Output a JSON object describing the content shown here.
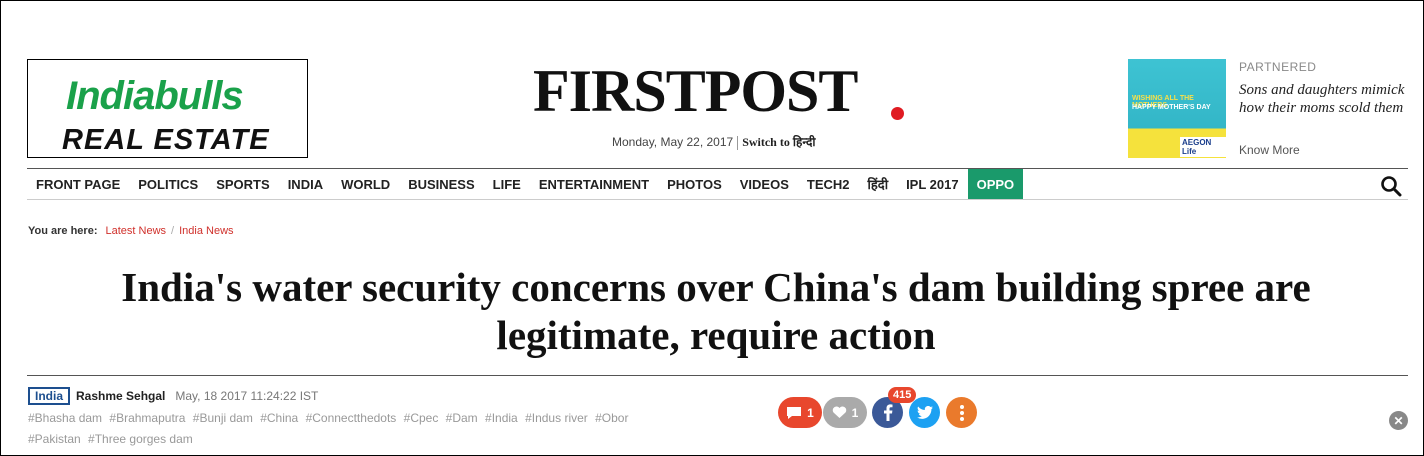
{
  "ad_left": {
    "line1": "Indiabulls",
    "line2": "REAL ESTATE"
  },
  "logo": {
    "text": "FIRSTPOST"
  },
  "dateline": {
    "date": "Monday, May 22, 2017",
    "switch": "Switch to हिन्दी"
  },
  "partnered": {
    "label": "PARTNERED",
    "image_line1": "WISHING ALL THE MOTHERS",
    "image_line2": "HAPPY MOTHER'S DAY",
    "image_brand": "AEGON Life",
    "title": "Sons and daughters mimick how their moms scold them",
    "more": "Know More"
  },
  "nav": {
    "items": [
      {
        "label": "FRONT PAGE"
      },
      {
        "label": "POLITICS"
      },
      {
        "label": "SPORTS"
      },
      {
        "label": "INDIA"
      },
      {
        "label": "WORLD"
      },
      {
        "label": "BUSINESS"
      },
      {
        "label": "LIFE"
      },
      {
        "label": "ENTERTAINMENT"
      },
      {
        "label": "PHOTOS"
      },
      {
        "label": "VIDEOS"
      },
      {
        "label": "TECH2"
      },
      {
        "label": "हिंदी"
      },
      {
        "label": "IPL 2017"
      },
      {
        "label": "OPPO"
      }
    ],
    "search_icon": "search-icon"
  },
  "breadcrumb": {
    "label": "You are here:",
    "items": [
      "Latest News",
      "India News"
    ]
  },
  "article": {
    "headline": "India's water security concerns over China's dam building spree are legitimate, require action",
    "section": "India",
    "author": "Rashme Sehgal",
    "timestamp": "May, 18 2017 11:24:22 IST",
    "tags": [
      "#Bhasha dam",
      "#Brahmaputra",
      "#Bunji dam",
      "#China",
      "#Connectthedots",
      "#Cpec",
      "#Dam",
      "#India",
      "#Indus river",
      "#Obor",
      "#Pakistan",
      "#Three gorges dam"
    ]
  },
  "share": {
    "comments": "1",
    "likes": "1",
    "facebook_count": "415"
  },
  "colors": {
    "brand_red": "#e01b22",
    "link_red": "#d0302b",
    "oppo_green": "#1a9a6b",
    "fb": "#3b5998",
    "twitter": "#1da1f2"
  }
}
